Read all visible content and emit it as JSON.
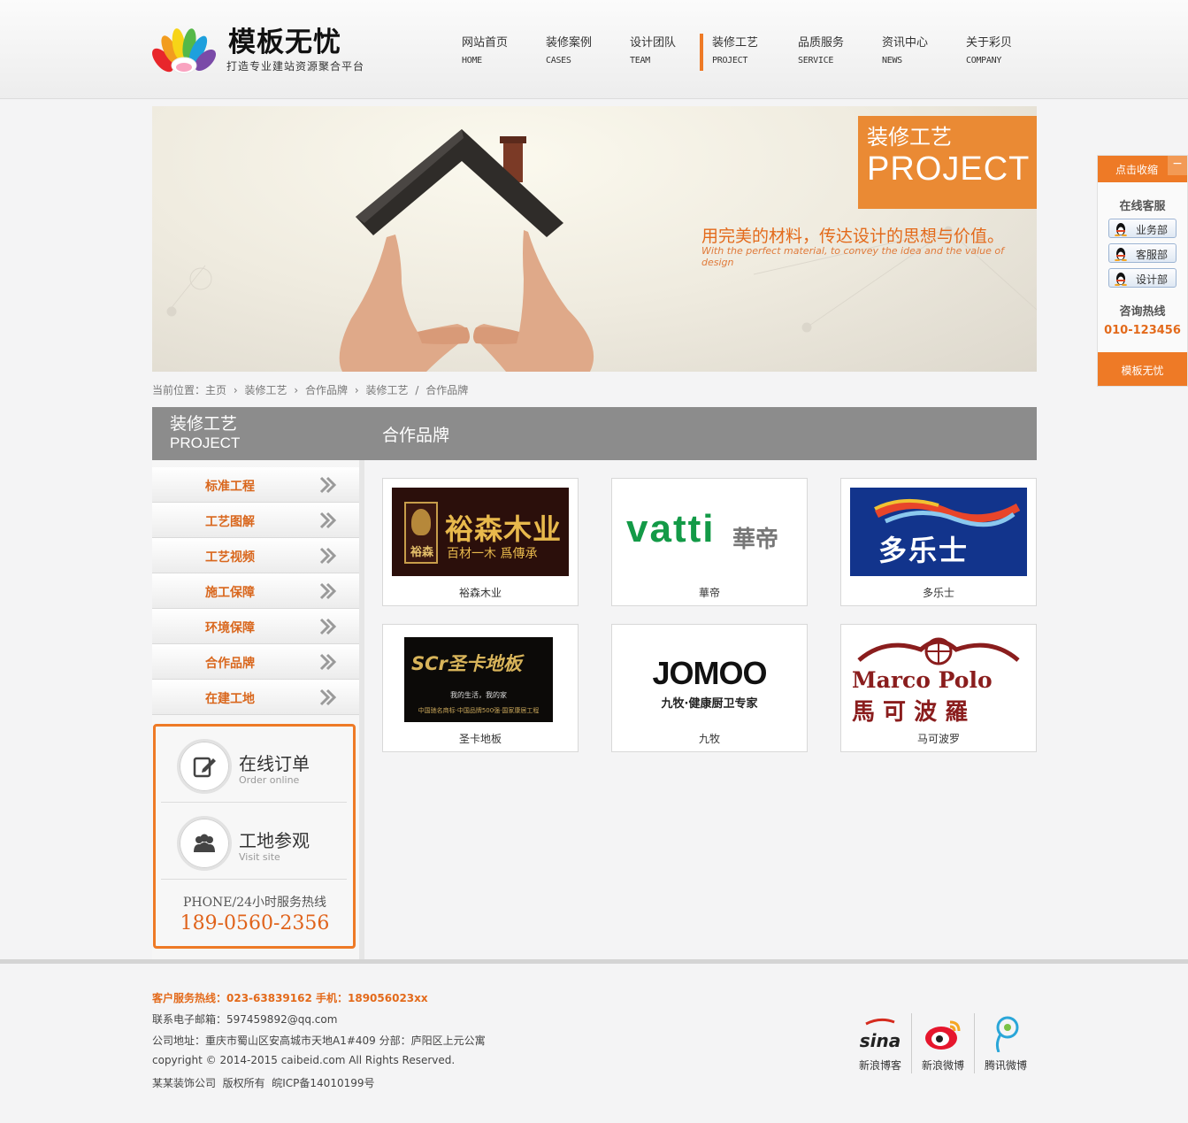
{
  "header": {
    "logo_title": "模板无忧",
    "logo_subtitle": "打造专业建站资源聚合平台",
    "nav": [
      {
        "cn": "网站首页",
        "en": "HOME"
      },
      {
        "cn": "装修案例",
        "en": "CASES"
      },
      {
        "cn": "设计团队",
        "en": "TEAM"
      },
      {
        "cn": "装修工艺",
        "en": "PROJECT",
        "active": true
      },
      {
        "cn": "品质服务",
        "en": "SERVICE"
      },
      {
        "cn": "资讯中心",
        "en": "NEWS"
      },
      {
        "cn": "关于彩贝",
        "en": "COMPANY"
      }
    ]
  },
  "banner": {
    "box_cn": "装修工艺",
    "box_en": "PROJECT",
    "slogan": "用完美的材料，传达设计的思想与价值。",
    "slogan_en": "With the perfect material, to convey the idea and the value of design"
  },
  "breadcrumb": {
    "prefix": "当前位置：",
    "items": [
      "主页",
      "›",
      "装修工艺",
      "›",
      "合作品牌",
      "›",
      "装修工艺",
      "/",
      "合作品牌"
    ]
  },
  "sidebar": {
    "head_cn": "装修工艺",
    "head_en": "PROJECT",
    "items": [
      "标准工程",
      "工艺图解",
      "工艺视频",
      "施工保障",
      "环境保障",
      "合作品牌",
      "在建工地"
    ],
    "order_title": "在线订单",
    "order_sub": "Order online",
    "visit_title": "工地参观",
    "visit_sub": "Visit site",
    "phone_label": "PHONE/24小时服务热线",
    "phone_number": "189-0560-2356"
  },
  "main": {
    "title": "合作品牌",
    "brands": [
      {
        "name": "裕森木业",
        "logo_text": "裕森木业",
        "logo_sub": "百材一木 爲傳承",
        "logo_side": "裕森"
      },
      {
        "name": "華帝",
        "logo_text": "vatti",
        "logo_sub": "華帝"
      },
      {
        "name": "多乐士",
        "logo_text": "多乐士"
      },
      {
        "name": "圣卡地板",
        "logo_text": "SCr圣卡地板",
        "logo_sub": "我的生活，我的家",
        "logo_sub2": "中国驰名商标·中国品牌500强·国家康居工程"
      },
      {
        "name": "九牧",
        "logo_text": "JOMOO",
        "logo_sub": "九牧·健康厨卫专家"
      },
      {
        "name": "马可波罗",
        "logo_text": "Marco Polo",
        "logo_sub": "馬 可 波 羅"
      }
    ]
  },
  "float_panel": {
    "toggle": "点击收缩",
    "title": "在线客服",
    "buttons": [
      "业务部",
      "客服部",
      "设计部"
    ],
    "hotline_label": "咨询热线",
    "hotline": "010-123456",
    "bottom": "模板无忧"
  },
  "footer": {
    "hotline": "客户服务热线：023-63839162 手机：189056023xx",
    "email": "联系电子邮箱：597459892@qq.com",
    "address": "公司地址：重庆市蜀山区安高城市天地A1#409 分部：庐阳区上元公寓",
    "copyright": "copyright © 2014-2015 caibeid.com All Rights Reserved.",
    "icp": "某某装饰公司  版权所有  皖ICP备14010199号",
    "social": [
      "新浪博客",
      "新浪微博",
      "腾讯微博"
    ],
    "social_sina_text": "sina"
  },
  "colors": {
    "accent": "#ee7a26",
    "header_bar": "#8c8c8c",
    "text_orange": "#d9671d"
  }
}
